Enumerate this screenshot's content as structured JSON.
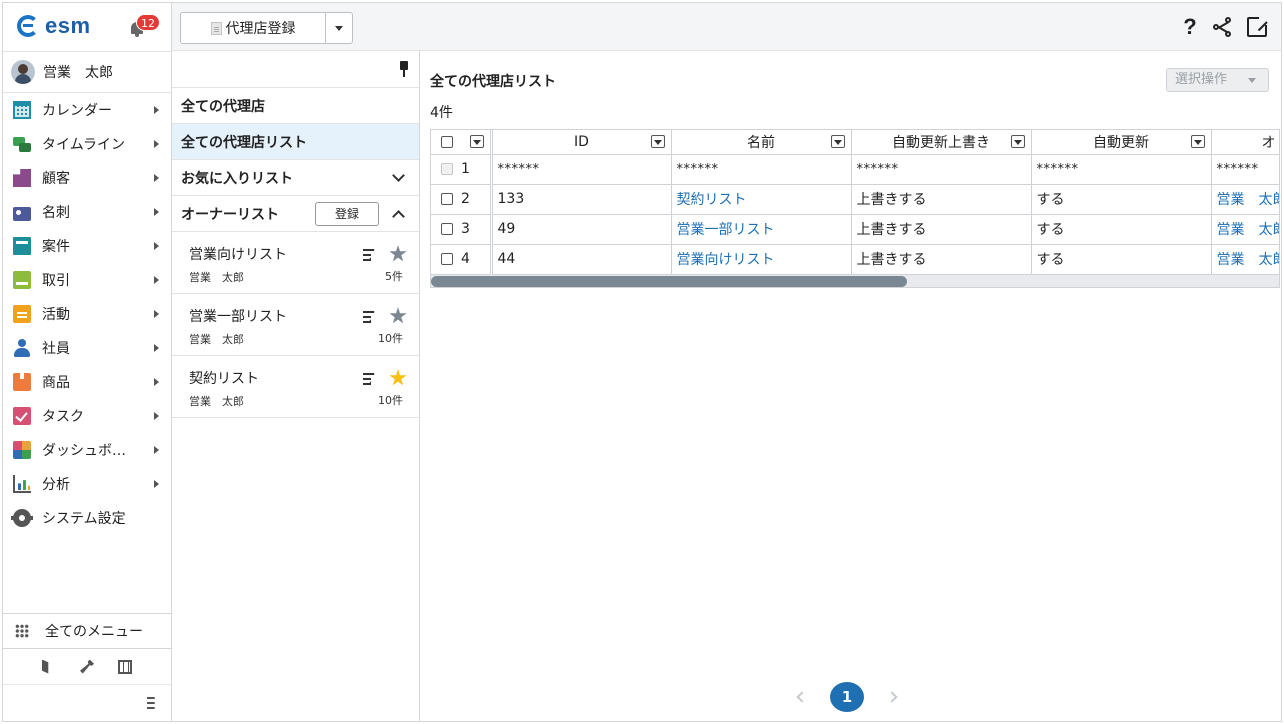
{
  "app": {
    "logo_text": "esm",
    "notifications": "12",
    "user_name": "営業　太郎"
  },
  "sidebar": {
    "items": [
      {
        "label": "カレンダー",
        "icon": "calendar-icon"
      },
      {
        "label": "タイムライン",
        "icon": "timeline-icon"
      },
      {
        "label": "顧客",
        "icon": "building-icon"
      },
      {
        "label": "名刺",
        "icon": "business-card-icon"
      },
      {
        "label": "案件",
        "icon": "folder-icon"
      },
      {
        "label": "取引",
        "icon": "deal-icon"
      },
      {
        "label": "活動",
        "icon": "clipboard-icon"
      },
      {
        "label": "社員",
        "icon": "person-icon"
      },
      {
        "label": "商品",
        "icon": "box-icon"
      },
      {
        "label": "タスク",
        "icon": "checkbox-icon"
      },
      {
        "label": "ダッシュボ…",
        "icon": "dashboard-icon"
      },
      {
        "label": "分析",
        "icon": "analytics-icon"
      },
      {
        "label": "システム設定",
        "icon": "gear-icon"
      }
    ],
    "all_menu": "全てのメニュー"
  },
  "toolbar": {
    "primary_button": "代理店登録"
  },
  "list_panel": {
    "all_agencies": "全ての代理店",
    "all_agency_list": "全ての代理店リスト",
    "favorites": "お気に入りリスト",
    "owner_list": "オーナーリスト",
    "register_button": "登録",
    "lists": [
      {
        "name": "営業向けリスト",
        "owner": "営業　太郎",
        "count": "5件",
        "starred": false
      },
      {
        "name": "営業一部リスト",
        "owner": "営業　太郎",
        "count": "10件",
        "starred": false
      },
      {
        "name": "契約リスト",
        "owner": "営業　太郎",
        "count": "10件",
        "starred": true
      }
    ]
  },
  "main": {
    "title": "全ての代理店リスト",
    "select_operation": "選択操作",
    "count": "4件",
    "columns": [
      "ID",
      "名前",
      "自動更新上書き",
      "自動更新",
      "オ"
    ],
    "rows": [
      {
        "num": "1",
        "id": "******",
        "name": "******",
        "overwrite": "******",
        "auto": "******",
        "owner": "******",
        "masked": true
      },
      {
        "num": "2",
        "id": "133",
        "name": "契約リスト",
        "overwrite": "上書きする",
        "auto": "する",
        "owner": "営業　太郎",
        "masked": false
      },
      {
        "num": "3",
        "id": "49",
        "name": "営業一部リスト",
        "overwrite": "上書きする",
        "auto": "する",
        "owner": "営業　太郎",
        "masked": false
      },
      {
        "num": "4",
        "id": "44",
        "name": "営業向けリスト",
        "overwrite": "上書きする",
        "auto": "する",
        "owner": "営業　太郎",
        "masked": false
      }
    ],
    "current_page": "1"
  },
  "colors": {
    "accent": "#1f6fb3",
    "badge": "#e53935",
    "selected_row": "#e5f2fb",
    "star_on": "#f6c114"
  }
}
